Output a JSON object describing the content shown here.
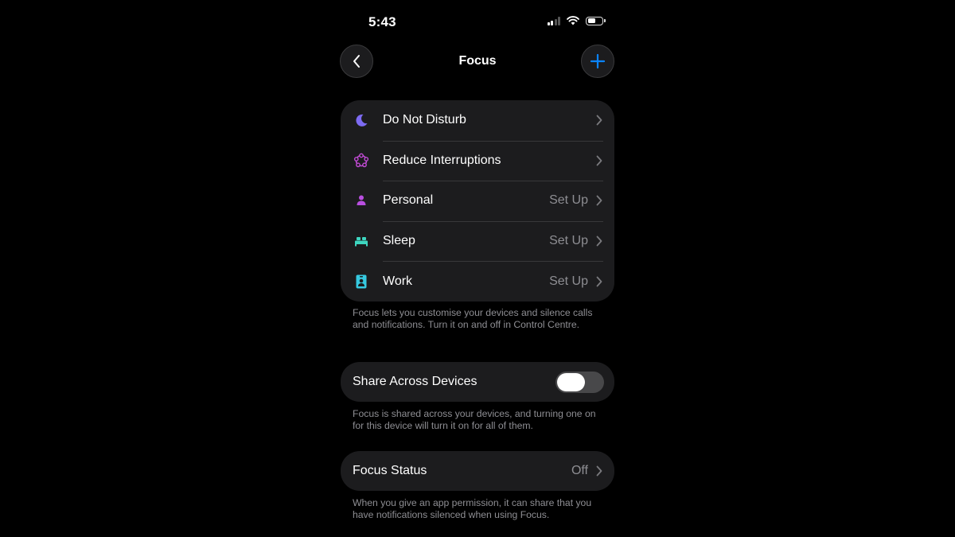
{
  "status_bar": {
    "time": "5:43"
  },
  "nav": {
    "title": "Focus",
    "back_icon": "chevron-left-icon",
    "add_icon": "plus-icon",
    "accent": "#0a84ff"
  },
  "focus_modes": [
    {
      "label": "Do Not Disturb",
      "detail": "",
      "icon": "moon-icon",
      "color": "#7d6bf2"
    },
    {
      "label": "Reduce Interruptions",
      "detail": "",
      "icon": "reduce-interruptions-icon",
      "color": "#c24bd6"
    },
    {
      "label": "Personal",
      "detail": "Set Up",
      "icon": "person-icon",
      "color": "#b94fe0"
    },
    {
      "label": "Sleep",
      "detail": "Set Up",
      "icon": "bed-icon",
      "color": "#3ed6c0"
    },
    {
      "label": "Work",
      "detail": "Set Up",
      "icon": "id-badge-icon",
      "color": "#36c9e0"
    }
  ],
  "focus_footnote": "Focus lets you customise your devices and silence calls and notifications. Turn it on and off in Control Centre.",
  "share": {
    "label": "Share Across Devices",
    "enabled": false,
    "footnote": "Focus is shared across your devices, and turning one on for this device will turn it on for all of them."
  },
  "focus_status": {
    "label": "Focus Status",
    "value": "Off",
    "footnote": "When you give an app permission, it can share that you have notifications silenced when using Focus."
  }
}
